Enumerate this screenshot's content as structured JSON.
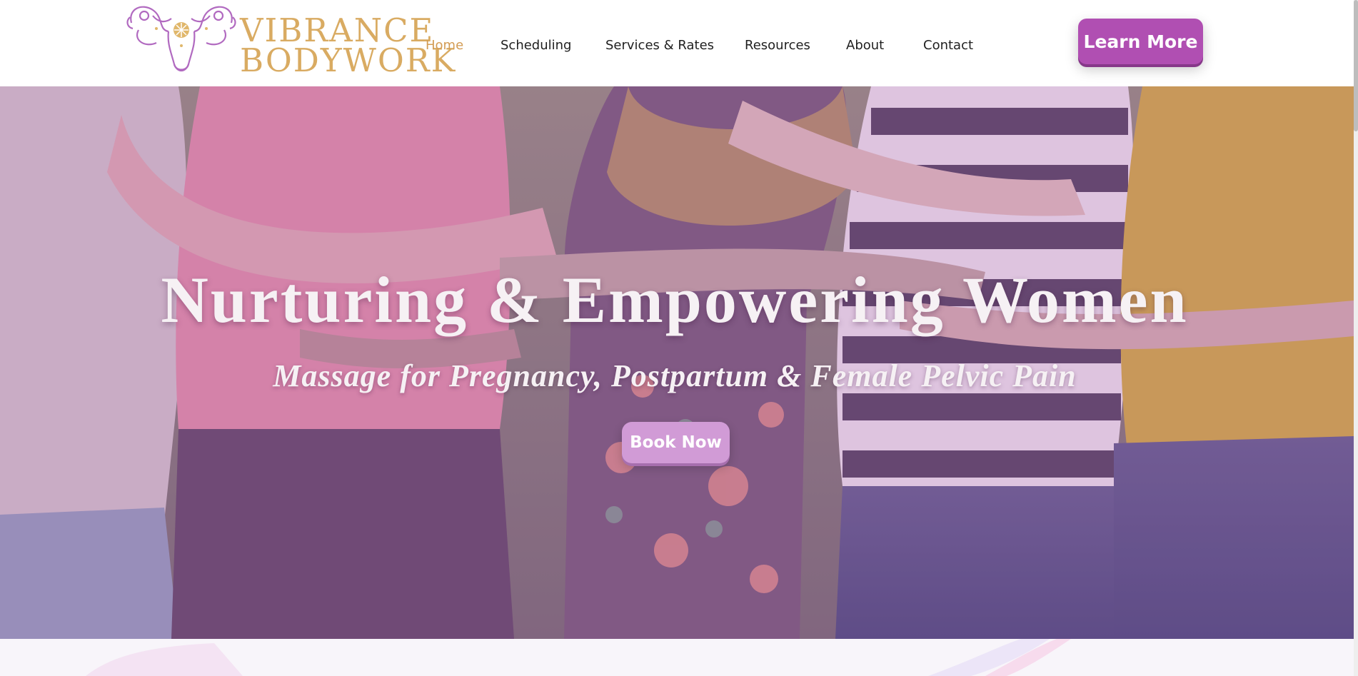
{
  "brand": {
    "logo_line1": "VIBRANCE",
    "logo_line2": "BODYWORK",
    "text_color": "#d9ab62",
    "emblem_color": "#b16ac0",
    "emblem_icon": "uterus-floral-emblem-icon"
  },
  "nav": {
    "items": [
      {
        "label": "Home",
        "active": true
      },
      {
        "label": "Scheduling",
        "active": false
      },
      {
        "label": "Services & Rates",
        "active": false
      },
      {
        "label": "Resources",
        "active": false
      },
      {
        "label": "About",
        "active": false
      },
      {
        "label": "Contact",
        "active": false
      }
    ],
    "active_color": "#d39c54",
    "cta_label": "Learn More",
    "cta_color": "#b04fb2"
  },
  "hero": {
    "title": "Nurturing & Empowering Women",
    "subtitle": "Massage for Pregnancy, Postpartum & Female Pelvic Pain",
    "button_label": "Book Now",
    "button_color": "#d19bd6",
    "background_image": "group-of-women-from-behind-with-arms-around-each-other"
  }
}
